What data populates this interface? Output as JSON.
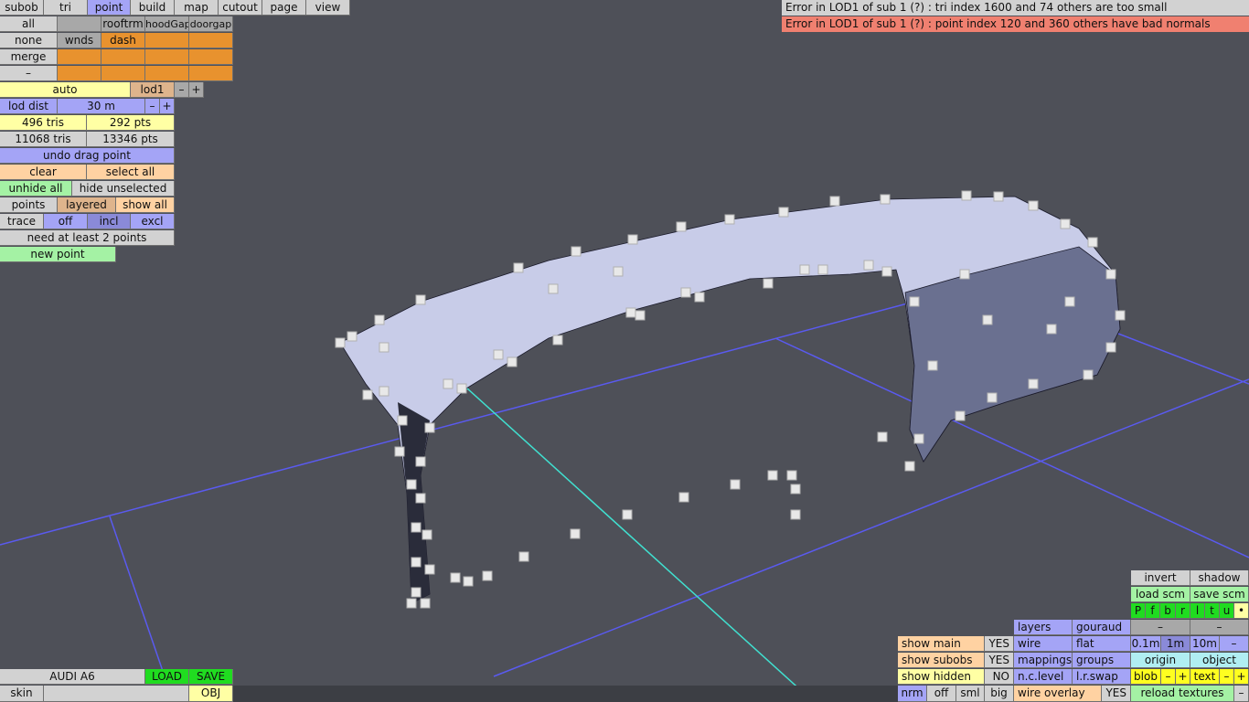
{
  "tabs": [
    "subob",
    "tri",
    "point",
    "build",
    "map",
    "cutout",
    "page",
    "view"
  ],
  "sel": {
    "all": "all",
    "rooftrm": "rooftrm",
    "hoodgap": "hoodGap",
    "doorgap": "doorgap",
    "none": "none",
    "wnds": "wnds",
    "dash": "dash",
    "merge": "merge",
    "minus": "–"
  },
  "lod": {
    "auto": "auto",
    "level": "lod1",
    "minus": "–",
    "plus": "+",
    "dist_label": "lod dist",
    "dist_value": "30 m"
  },
  "stats": {
    "tris": "496 tris",
    "pts": "292 pts",
    "total_tris": "11068 tris",
    "total_pts": "13346 pts"
  },
  "actions": {
    "undo": "undo drag point",
    "clear": "clear",
    "select_all": "select all",
    "unhide_all": "unhide all",
    "hide_unselected": "hide unselected",
    "points": "points",
    "layered": "layered",
    "show_all": "show all",
    "trace": "trace",
    "off": "off",
    "incl": "incl",
    "excl": "excl",
    "need": "need at least 2 points",
    "new_point": "new point"
  },
  "errors": [
    "Error in LOD1 of sub 1 (?) : tri index 1600 and 74 others are too small",
    "Error in LOD1 of sub 1 (?) : point index 120 and 360 others have bad normals"
  ],
  "file": {
    "name": "AUDI A6",
    "load": "LOAD",
    "save": "SAVE",
    "skin": "skin",
    "obj": "OBJ"
  },
  "br": {
    "invert": "invert",
    "shadow": "shadow",
    "load_scm": "load scm",
    "save_scm": "save scm",
    "views": [
      "P",
      "f",
      "b",
      "r",
      "l",
      "t",
      "u",
      "•"
    ],
    "layers": "layers",
    "gouraud": "gouraud",
    "dash1": "–",
    "dash2": "–",
    "show_main": "show main",
    "show_main_v": "YES",
    "wire": "wire",
    "flat": "flat",
    "g01": "0.1m",
    "g1": "1m",
    "g10": "10m",
    "gm": "–",
    "show_subobs": "show subobs",
    "show_subobs_v": "YES",
    "mappings": "mappings",
    "groups": "groups",
    "origin": "origin",
    "object": "object",
    "show_hidden": "show hidden",
    "show_hidden_v": "NO",
    "nclevel": "n.c.level",
    "lrswap": "l.r.swap",
    "blob": "blob",
    "bm": "–",
    "bp": "+",
    "text": "text",
    "tm": "–",
    "tp": "+",
    "nrm": "nrm",
    "off": "off",
    "sml": "sml",
    "big": "big",
    "wire_overlay": "wire overlay",
    "wire_overlay_v": "YES",
    "reload": "reload textures",
    "rm": "–"
  },
  "colors": {
    "background": "#4e5058",
    "grid": "#5a5af0",
    "axis": "#40e0d0",
    "error1": "#d2d2d2",
    "error2": "#f08070"
  }
}
